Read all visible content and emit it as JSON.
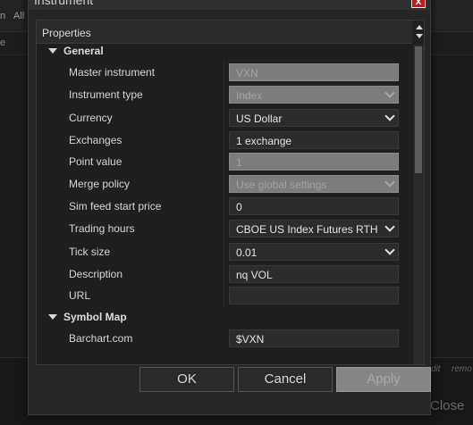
{
  "background": {
    "toolbar_left": "n",
    "toolbar_item": "All",
    "row_label": "e",
    "right_links": [
      "dit",
      "remo"
    ],
    "close_label": "Close"
  },
  "dialog": {
    "title": "Instrument",
    "close_glyph": "x"
  },
  "grid": {
    "header": "Properties",
    "sections": [
      {
        "title": "General",
        "rows": [
          {
            "label": "Master instrument",
            "value": "VXN",
            "type": "text",
            "disabled": true
          },
          {
            "label": "Instrument type",
            "value": "Index",
            "type": "select",
            "disabled": true
          },
          {
            "label": "Currency",
            "value": "US Dollar",
            "type": "select",
            "disabled": false
          },
          {
            "label": "Exchanges",
            "value": "1 exchange",
            "type": "text",
            "disabled": false
          },
          {
            "label": "Point value",
            "value": "1",
            "type": "text",
            "disabled": true
          },
          {
            "label": "Merge policy",
            "value": "Use global settings",
            "type": "select",
            "disabled": true
          },
          {
            "label": "Sim feed start price",
            "value": "0",
            "type": "text",
            "disabled": false
          },
          {
            "label": "Trading hours",
            "value": "CBOE US Index Futures RTH",
            "type": "select",
            "disabled": false
          },
          {
            "label": "Tick size",
            "value": "0.01",
            "type": "select",
            "disabled": false
          },
          {
            "label": "Description",
            "value": "nq VOL",
            "type": "text",
            "disabled": false
          },
          {
            "label": "URL",
            "value": "",
            "type": "text",
            "disabled": false
          }
        ]
      },
      {
        "title": "Symbol Map",
        "rows": [
          {
            "label": "Barchart.com",
            "value": "$VXN",
            "type": "text",
            "disabled": false
          }
        ]
      }
    ]
  },
  "buttons": {
    "ok": "OK",
    "cancel": "Cancel",
    "apply": "Apply"
  }
}
